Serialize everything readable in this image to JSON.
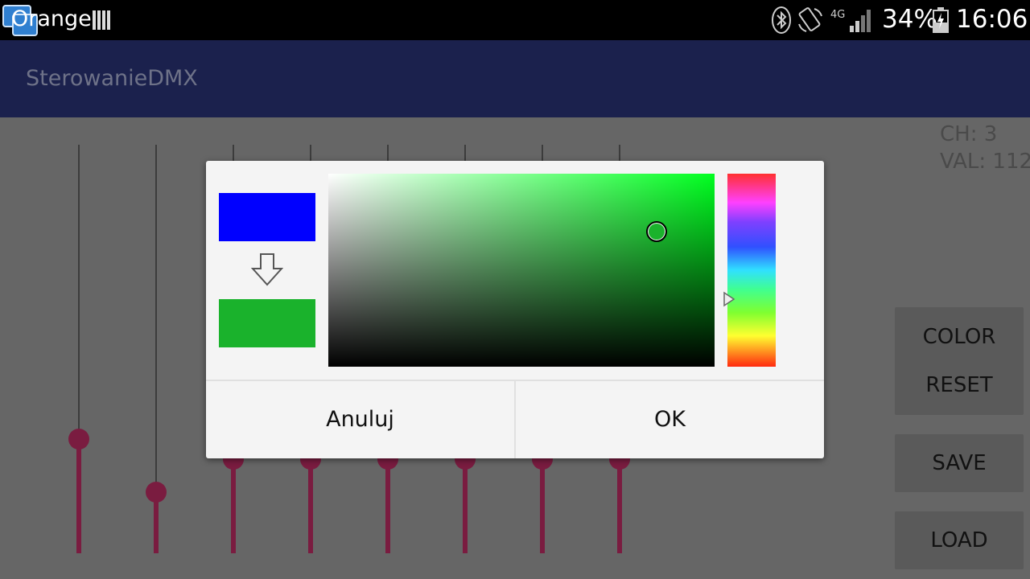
{
  "status_bar": {
    "carrier": "Orange",
    "battery_percent": "34%",
    "time": "16:06",
    "network_type": "4G",
    "icons": [
      "screen-mirror-icon",
      "sim-bars-icon",
      "bluetooth-icon",
      "screen-rotation-icon",
      "signal-icon",
      "battery-charging-icon"
    ]
  },
  "app_bar": {
    "title": "SterowanieDMX"
  },
  "readout": {
    "channel": "CH: 3",
    "value": "VAL: 112"
  },
  "faders": [
    {
      "level": 0.28
    },
    {
      "level": 0.15
    },
    {
      "level": 0.23
    },
    {
      "level": 0.23
    },
    {
      "level": 0.23
    },
    {
      "level": 0.23
    },
    {
      "level": 0.23
    },
    {
      "level": 0.23
    }
  ],
  "side_buttons": {
    "color_label": "COLOR",
    "reset_label": "RESET",
    "save_label": "SAVE",
    "load_label": "LOAD"
  },
  "color_dialog": {
    "old_color": "#0000ff",
    "new_color": "#1ab22c",
    "hue_color": "#00ff20",
    "saturation": 0.85,
    "brightness": 0.7,
    "hue_position": 0.65,
    "cancel_label": "Anuluj",
    "ok_label": "OK"
  },
  "colors": {
    "status_bar": "#000000",
    "app_bar": "#1b214d",
    "fader_accent": "#7a1c40",
    "dim_background": "#666666"
  }
}
